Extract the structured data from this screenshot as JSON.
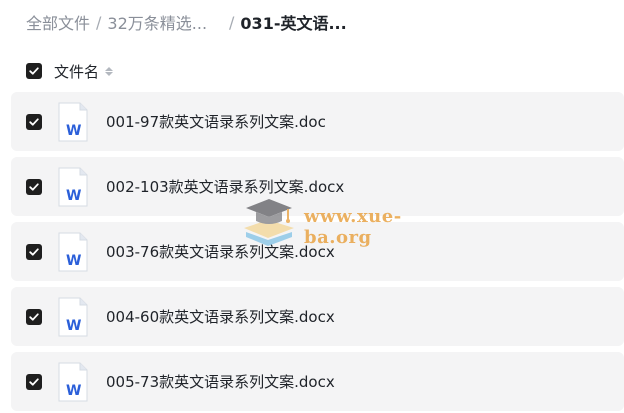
{
  "breadcrumb": {
    "items": [
      "全部文件",
      "32万条精选...",
      "031-英文语..."
    ],
    "separator": "/"
  },
  "header": {
    "column_label": "文件名",
    "select_all_checked": true
  },
  "files": [
    {
      "name": "001-97款英文语录系列文案.doc",
      "checked": true,
      "type": "word"
    },
    {
      "name": "002-103款英文语录系列文案.docx",
      "checked": true,
      "type": "word"
    },
    {
      "name": "003-76款英文语录系列文案.docx",
      "checked": true,
      "type": "word"
    },
    {
      "name": "004-60款英文语录系列文案.docx",
      "checked": true,
      "type": "word"
    },
    {
      "name": "005-73款英文语录系列文案.docx",
      "checked": true,
      "type": "word"
    }
  ],
  "watermark": {
    "text": "www.xue-ba.org",
    "icon": "graduation-cap-icon"
  },
  "colors": {
    "word_blue": "#2b5fd9",
    "row_bg": "#f4f4f5",
    "checkbox": "#1f1f1f",
    "watermark": "#e9a84f"
  }
}
